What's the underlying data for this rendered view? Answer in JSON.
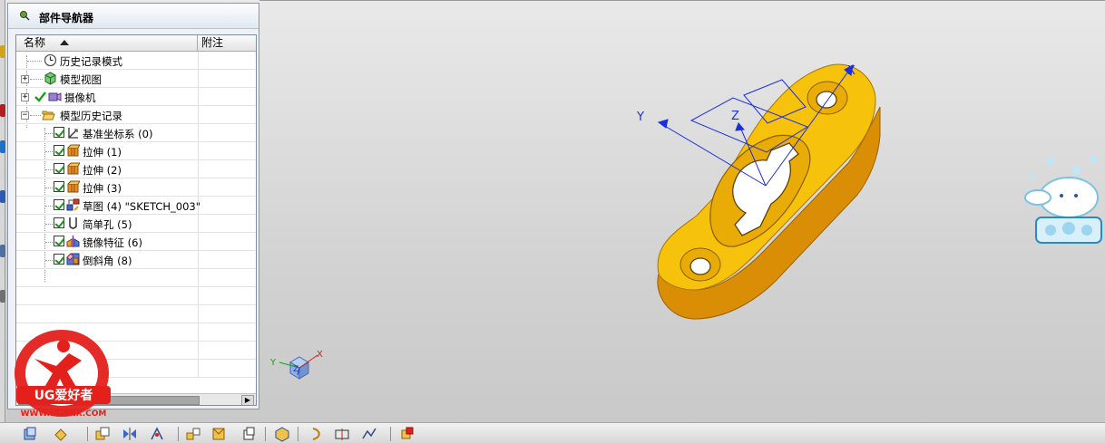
{
  "navigator": {
    "title": "部件导航器",
    "columns": {
      "name": "名称",
      "attachment": "附注"
    },
    "rows": [
      {
        "label": "历史记录模式",
        "icon": "clock-icon"
      },
      {
        "label": "模型视图",
        "icon": "model-view-icon"
      },
      {
        "label": "摄像机",
        "icon": "camera-icon"
      },
      {
        "label": "模型历史记录",
        "icon": "folder-open-icon"
      },
      {
        "label": "基准坐标系 (0)",
        "icon": "datum-csys-icon"
      },
      {
        "label": "拉伸 (1)",
        "icon": "extrude-icon"
      },
      {
        "label": "拉伸 (2)",
        "icon": "extrude-icon"
      },
      {
        "label": "拉伸 (3)",
        "icon": "extrude-icon"
      },
      {
        "label": "草图 (4) \"SKETCH_003\"",
        "icon": "sketch-icon"
      },
      {
        "label": "简单孔 (5)",
        "icon": "hole-icon"
      },
      {
        "label": "镜像特征 (6)",
        "icon": "mirror-feature-icon"
      },
      {
        "label": "倒斜角 (8)",
        "icon": "chamfer-icon"
      }
    ]
  },
  "viewport": {
    "axis_labels": {
      "x": "X",
      "y": "Y",
      "z": "Z"
    },
    "triad_labels": {
      "x": "X",
      "y": "Y",
      "z": "Z"
    },
    "part_color": "#f7c20c",
    "datum_color": "#1c2fe0"
  },
  "watermark": {
    "brand": "UG爱好者",
    "url": "WWW.UGSNX.COM",
    "color": "#e3201b"
  },
  "colors": {
    "panel_bg": "#eef2f7",
    "check_green": "#119a11"
  }
}
